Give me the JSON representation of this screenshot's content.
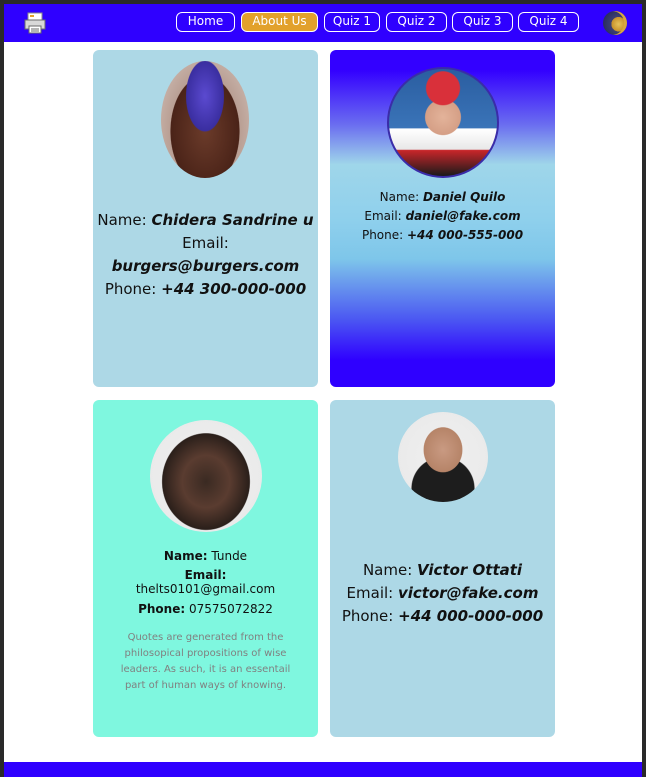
{
  "nav": {
    "items": [
      {
        "label": "Home"
      },
      {
        "label": "About Us",
        "active": true
      },
      {
        "label": "Quiz 1"
      },
      {
        "label": "Quiz 2"
      },
      {
        "label": "Quiz 3"
      },
      {
        "label": "Quiz 4"
      }
    ],
    "logo_icon": "printer-icon",
    "theme_icon": "moon-icon"
  },
  "colors": {
    "nav_bg": "#2f00ff",
    "active_tab": "#e2a12c",
    "card_blue": "#add8e6",
    "card_mint": "#7ff7df"
  },
  "cards": [
    {
      "name_label": "Name:",
      "name": "Chidera Sandrine u",
      "email_label": "Email:",
      "email": "burgers@burgers.com",
      "phone_label": "Phone:",
      "phone": "+44 300-000-000"
    },
    {
      "name_label": "Name:",
      "name": "Daniel Quilo",
      "email_label": "Email:",
      "email": "daniel@fake.com",
      "phone_label": "Phone:",
      "phone": "+44 000-555-000"
    },
    {
      "name_label": "Name:",
      "name": "Tunde",
      "email_label": "Email:",
      "email": "thelts0101@gmail.com",
      "phone_label": "Phone:",
      "phone": "07575072822",
      "quote": "Quotes are generated from the philosopical propositions of wise leaders. As such, it is an essentail part of human ways of knowing."
    },
    {
      "name_label": "Name:",
      "name": "Victor Ottati",
      "email_label": "Email:",
      "email": "victor@fake.com",
      "phone_label": "Phone:",
      "phone": "+44 000-000-000"
    }
  ]
}
